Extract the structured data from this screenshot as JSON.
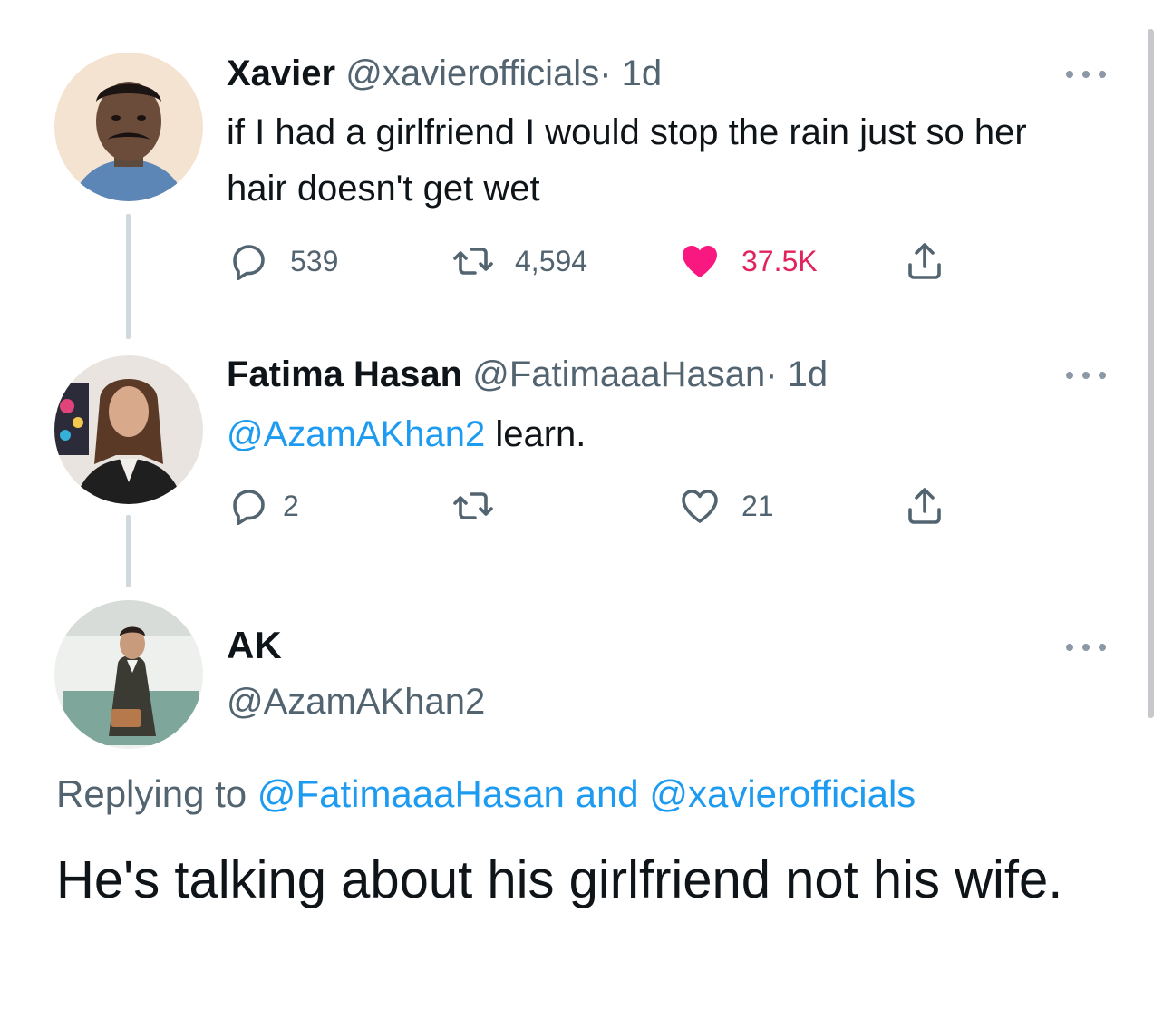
{
  "colors": {
    "text_primary": "#0f1419",
    "text_secondary": "#536471",
    "link": "#1d9bf0",
    "like": "#e0245e",
    "thread_line": "#cfd9de"
  },
  "tweets": [
    {
      "name": "Xavier",
      "handle": "@xavierofficials",
      "separator": "·",
      "time": "1d",
      "text": "if I had a girlfriend I would stop the rain just so her hair doesn't get wet",
      "actions": {
        "replies": "539",
        "retweets": "4,594",
        "likes": "37.5K",
        "liked": true
      }
    },
    {
      "name": "Fatima Hasan",
      "handle": "@FatimaaaHasan",
      "separator": "·",
      "time": "1d",
      "mention": "@AzamAKhan2",
      "text": " learn.",
      "actions": {
        "replies": "2",
        "retweets": "",
        "likes": "21",
        "liked": false
      }
    }
  ],
  "main_tweet": {
    "name": "AK",
    "handle": "@AzamAKhan2",
    "replying_prefix": "Replying to ",
    "replying_user1": "@FatimaaaHasan",
    "replying_and": " and ",
    "replying_user2": "@xavierofficials",
    "text": "He's talking about his girlfriend not his wife."
  },
  "icons": {
    "reply": "reply-icon",
    "retweet": "retweet-icon",
    "like": "heart-icon",
    "share": "share-icon",
    "more": "more-icon"
  }
}
